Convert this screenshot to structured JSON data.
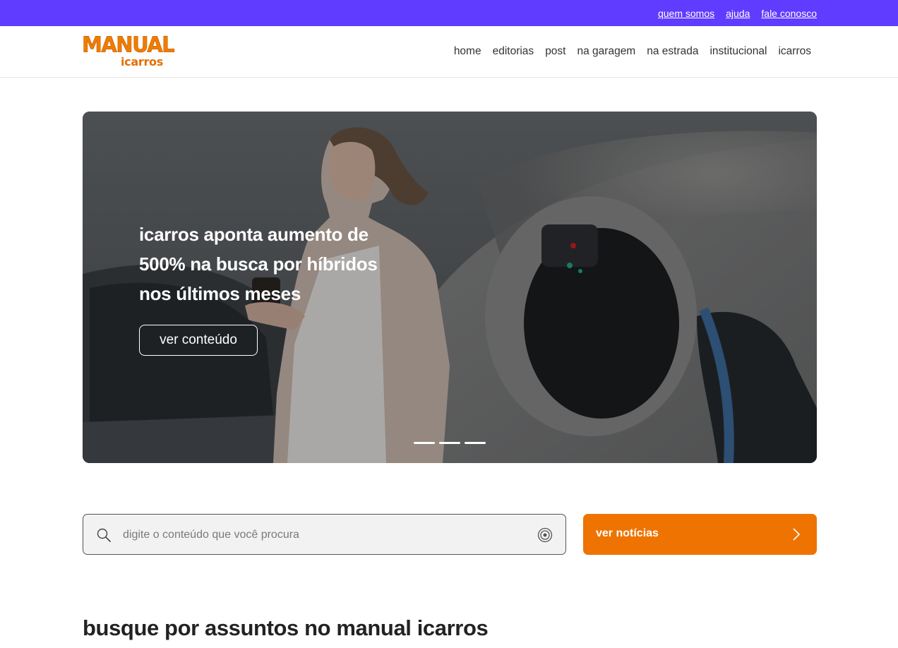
{
  "topbar": {
    "links": [
      "quem somos",
      "ajuda",
      "fale conosco"
    ],
    "background": "#5f3cff"
  },
  "header": {
    "logo": {
      "line1": "MANUAL",
      "line2": "icarros",
      "color": "#f07c00"
    },
    "nav": [
      "home",
      "editorias",
      "post",
      "na garagem",
      "na estrada",
      "institucional",
      "icarros"
    ]
  },
  "hero": {
    "title": "icarros aponta aumento de 500% na busca por híbridos nos últimos meses",
    "button_label": "ver conteúdo",
    "slides_count": 3
  },
  "search": {
    "placeholder": "digite o conteúdo que você procura",
    "value": ""
  },
  "news_button": {
    "label": "ver notícias",
    "color": "#ef7300"
  },
  "section": {
    "title": "busque por assuntos no manual icarros"
  },
  "icons": {
    "search": "magnifier-icon",
    "voice": "voice-search-icon",
    "arrow": "chevron-right-icon"
  }
}
